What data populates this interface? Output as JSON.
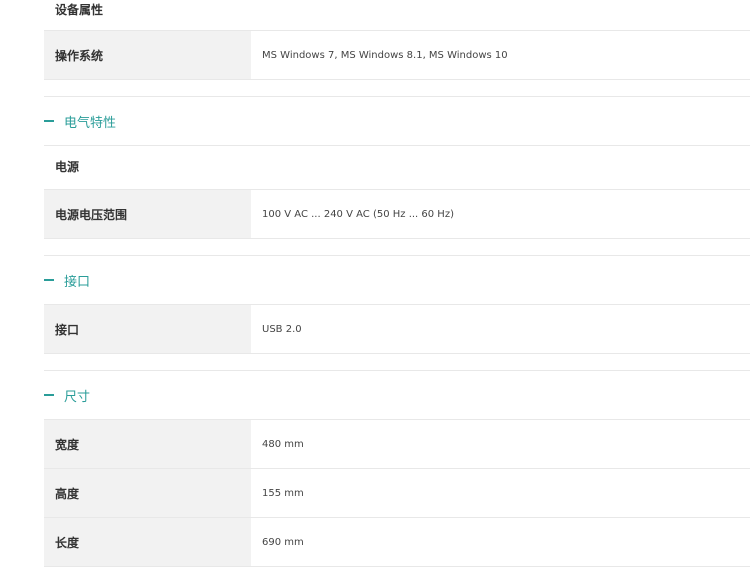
{
  "device_props": {
    "heading": "设备属性",
    "rows": [
      {
        "label": "操作系统",
        "value": "MS Windows 7, MS Windows 8.1, MS Windows 10"
      }
    ]
  },
  "electrical": {
    "title": "电气特性",
    "sub_heading": "电源",
    "rows": [
      {
        "label": "电源电压范围",
        "value": "100 V AC ... 240 V AC (50 Hz ... 60 Hz)"
      }
    ]
  },
  "interface": {
    "title": "接口",
    "rows": [
      {
        "label": "接口",
        "value": "USB 2.0"
      }
    ]
  },
  "dimensions": {
    "title": "尺寸",
    "rows": [
      {
        "label": "宽度",
        "value": "480 mm"
      },
      {
        "label": "高度",
        "value": "155 mm"
      },
      {
        "label": "长度",
        "value": "690 mm"
      }
    ]
  },
  "colors": {
    "accent": "#2a9d99",
    "label_bg": "#f2f2f2",
    "border": "#e8e8e8"
  }
}
